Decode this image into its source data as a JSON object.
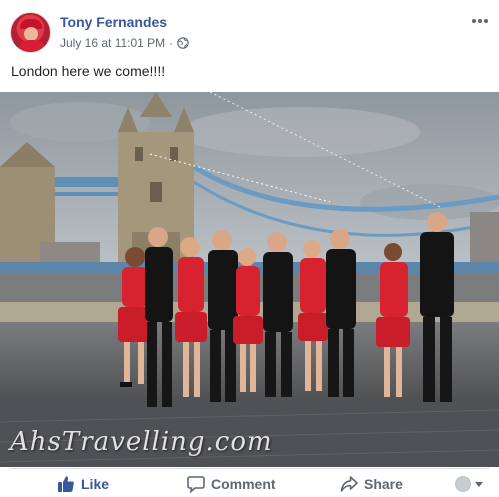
{
  "post": {
    "author": "Tony Fernandes",
    "timestamp": "July 16 at 11:01 PM",
    "separator": "·",
    "privacy_icon": "globe-icon",
    "text": "London here we come!!!!",
    "photo_watermark": "AhsTravelling.com"
  },
  "actions": {
    "like": "Like",
    "comment": "Comment",
    "share": "Share"
  },
  "colors": {
    "link_blue": "#385898",
    "muted_gray": "#606770",
    "divider": "#dadde1"
  }
}
